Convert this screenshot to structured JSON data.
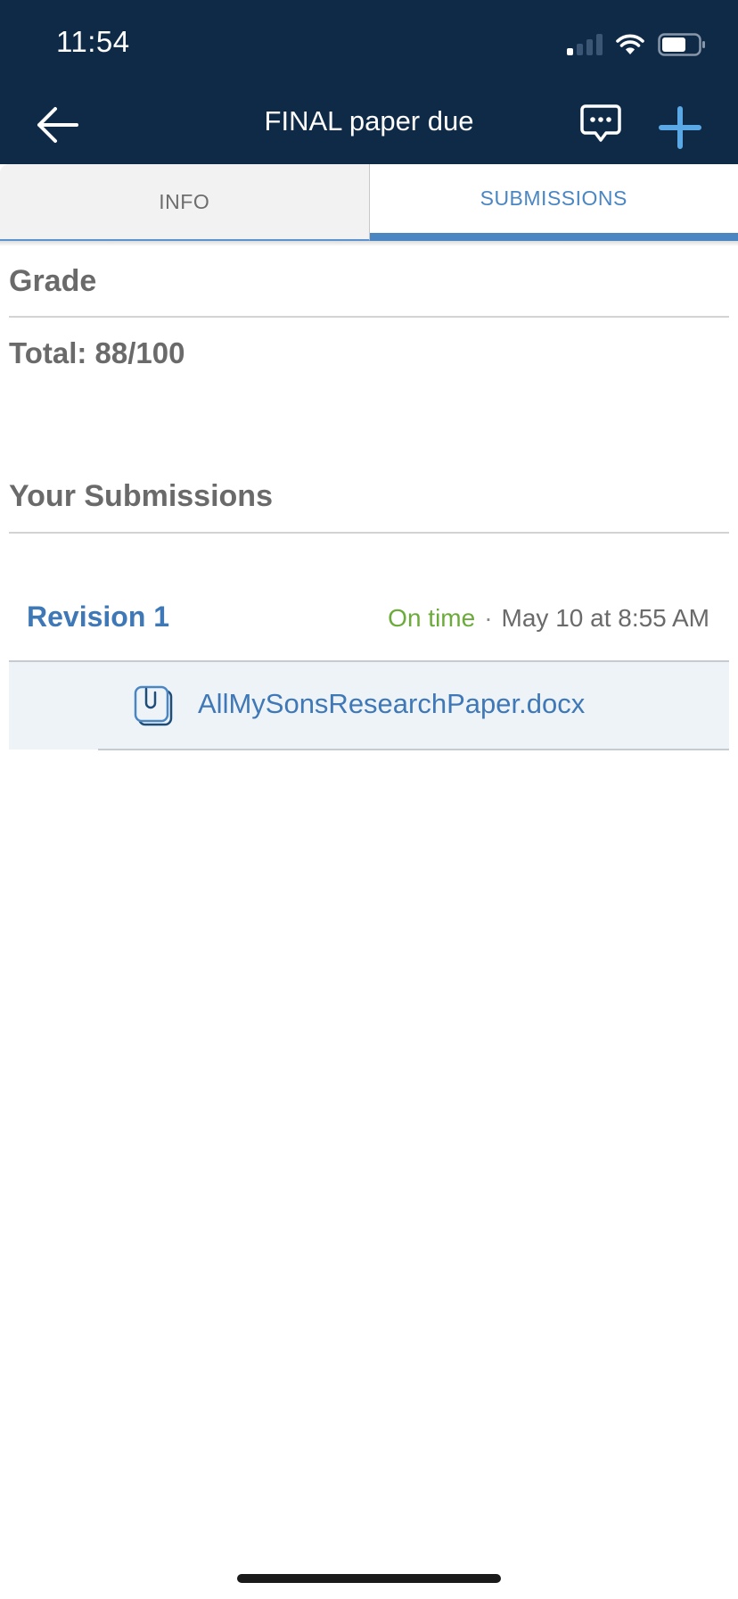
{
  "status_bar": {
    "time": "11:54"
  },
  "nav": {
    "title": "FINAL paper due",
    "icons": [
      "back-arrow-icon",
      "chat-bubble-icon",
      "plus-icon"
    ]
  },
  "tabs": [
    {
      "label": "INFO",
      "selected": false
    },
    {
      "label": "SUBMISSIONS",
      "selected": true
    }
  ],
  "grade": {
    "heading": "Grade",
    "total": "Total: 88/100"
  },
  "submissions": {
    "heading": "Your Submissions",
    "revision": {
      "title": "Revision 1",
      "status": "On time",
      "separator": "·",
      "date": "May 10 at 8:55 AM"
    },
    "file": {
      "name": "AllMySonsResearchPaper.docx",
      "icon": "paperclip-document-icon"
    }
  },
  "colors": {
    "header_bg": "#0f2a47",
    "accent": "#4a86c2",
    "on_time": "#6bab3a",
    "plus": "#5aa9e6"
  }
}
